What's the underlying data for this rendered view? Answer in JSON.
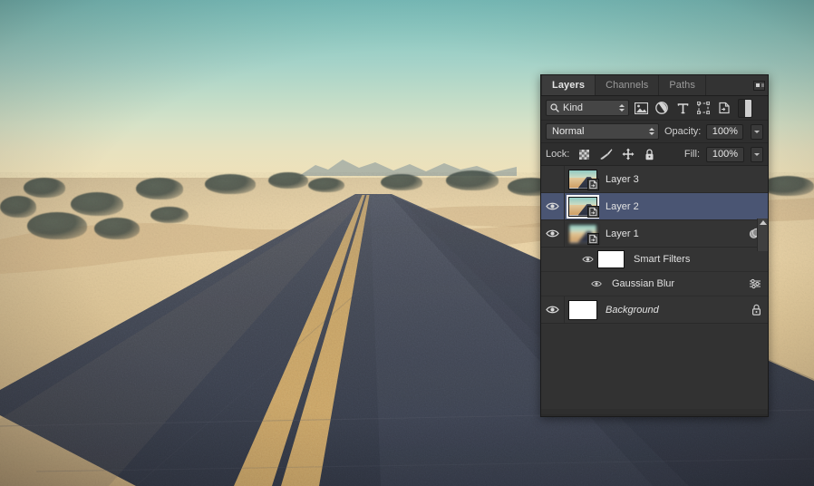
{
  "photo": {
    "description": "desert road through sand dunes at dusk",
    "sky_top_color": "#7cc3c0",
    "sky_bottom_color": "#f2dcae",
    "sand_color": "#eed7a9",
    "asphalt_color": "#3a3f4e",
    "road_line_color": "#c79a5c"
  },
  "panel": {
    "tabs": [
      {
        "label": "Layers",
        "active": true
      },
      {
        "label": "Channels",
        "active": false
      },
      {
        "label": "Paths",
        "active": false
      }
    ],
    "menu_icon": "panel-menu-icon",
    "filter": {
      "search_icon": "search-icon",
      "kind_label": "Kind",
      "type_icons": [
        "pixel-layer-filter-icon",
        "adjustment-layer-filter-icon",
        "type-layer-filter-icon",
        "shape-layer-filter-icon",
        "smart-object-filter-icon"
      ],
      "toggle_icon": "filter-enable-toggle-icon"
    },
    "blend": {
      "mode": "Normal",
      "opacity_label": "Opacity:",
      "opacity_value": "100%",
      "fill_label": "Fill:",
      "fill_value": "100%"
    },
    "lock": {
      "label": "Lock:",
      "buttons": [
        "lock-transparent-pixels-icon",
        "lock-image-pixels-icon",
        "lock-position-icon",
        "lock-all-icon"
      ]
    },
    "layers": [
      {
        "name": "Layer 3",
        "visible": false,
        "selected": false,
        "thumb": "photo",
        "smart_object": true,
        "italic": false
      },
      {
        "name": "Layer 2",
        "visible": true,
        "selected": true,
        "thumb": "photo",
        "smart_object": true,
        "italic": false
      },
      {
        "name": "Layer 1",
        "visible": true,
        "selected": false,
        "thumb": "photo-blurred",
        "smart_object": true,
        "italic": false,
        "right_icon": "smart-filter-badge-icon"
      }
    ],
    "smart_filters": {
      "group_label": "Smart Filters",
      "group_visible": true,
      "group_mask_thumb": "white",
      "items": [
        {
          "label": "Gaussian Blur",
          "visible": true,
          "settings_icon": "filter-options-icon"
        }
      ]
    },
    "background_layer": {
      "name": "Background",
      "visible": true,
      "locked": true,
      "thumb": "white",
      "italic": true
    },
    "scrollbar": "layer-list-scrollbar"
  }
}
